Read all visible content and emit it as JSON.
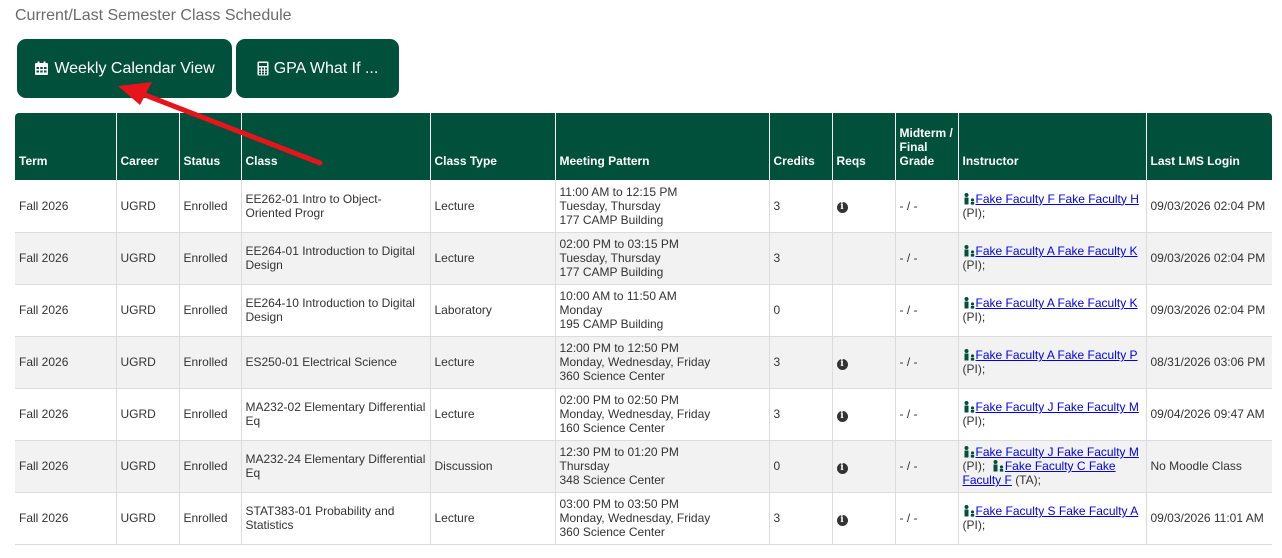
{
  "page": {
    "heading": "Current/Last Semester Class Schedule"
  },
  "buttons": {
    "weekly_label": "Weekly Calendar View",
    "gpa_label": "GPA What If ..."
  },
  "table": {
    "headers": {
      "term": "Term",
      "career": "Career",
      "status": "Status",
      "class": "Class",
      "class_type": "Class Type",
      "meeting": "Meeting Pattern",
      "credits": "Credits",
      "reqs": "Reqs",
      "grade_line1": "Midterm /",
      "grade_line2": "Final",
      "grade_line3": "Grade",
      "instructor": "Instructor",
      "lms": "Last LMS Login"
    },
    "rows": [
      {
        "term": "Fall 2026",
        "career": "UGRD",
        "status": "Enrolled",
        "class": "EE262-01 Intro to Object-Oriented Progr",
        "type": "Lecture",
        "time": "11:00 AM to 12:15 PM",
        "days": "Tuesday, Thursday",
        "location": "177 CAMP Building",
        "credits": "3",
        "grade": "- / -",
        "instructor": "Fake Faculty F Fake Faculty H",
        "role": "(PI);",
        "lms": "09/03/2026 02:04 PM"
      },
      {
        "term": "Fall 2026",
        "career": "UGRD",
        "status": "Enrolled",
        "class": "EE264-01 Introduction to Digital Design",
        "type": "Lecture",
        "time": "02:00 PM to 03:15 PM",
        "days": "Tuesday, Thursday",
        "location": "177 CAMP Building",
        "credits": "3",
        "grade": "- / -",
        "instructor": "Fake Faculty A Fake Faculty K",
        "role": "(PI);",
        "lms": "09/03/2026 02:04 PM"
      },
      {
        "term": "Fall 2026",
        "career": "UGRD",
        "status": "Enrolled",
        "class": "EE264-10 Introduction to Digital Design",
        "type": "Laboratory",
        "time": "10:00 AM to 11:50 AM",
        "days": "Monday",
        "location": "195 CAMP Building",
        "credits": "0",
        "grade": "- / -",
        "instructor": "Fake Faculty A Fake Faculty K",
        "role": "(PI);",
        "lms": "09/03/2026 02:04 PM"
      },
      {
        "term": "Fall 2026",
        "career": "UGRD",
        "status": "Enrolled",
        "class": "ES250-01 Electrical Science",
        "type": "Lecture",
        "time": "12:00 PM to 12:50 PM",
        "days": "Monday, Wednesday, Friday",
        "location": "360 Science Center",
        "credits": "3",
        "grade": "- / -",
        "instructor": "Fake Faculty A Fake Faculty P",
        "role": "(PI);",
        "lms": "08/31/2026 03:06 PM"
      },
      {
        "term": "Fall 2026",
        "career": "UGRD",
        "status": "Enrolled",
        "class": "MA232-02 Elementary Differential Eq",
        "type": "Lecture",
        "time": "02:00 PM to 02:50 PM",
        "days": "Monday, Wednesday, Friday",
        "location": "160 Science Center",
        "credits": "3",
        "grade": "- / -",
        "instructor": "Fake Faculty J Fake Faculty M",
        "role": "(PI);",
        "lms": "09/04/2026 09:47 AM"
      },
      {
        "term": "Fall 2026",
        "career": "UGRD",
        "status": "Enrolled",
        "class": "MA232-24 Elementary Differential Eq",
        "type": "Discussion",
        "time": "12:30 PM to 01:20 PM",
        "days": "Thursday",
        "location": "348 Science Center",
        "credits": "0",
        "grade": "- / -",
        "instructor": "Fake Faculty J Fake Faculty M",
        "role": "(PI);",
        "instructor2": "Fake Faculty C Fake Faculty F",
        "role2": "(TA);",
        "lms": "No Moodle Class"
      },
      {
        "term": "Fall 2026",
        "career": "UGRD",
        "status": "Enrolled",
        "class": "STAT383-01 Probability and Statistics",
        "type": "Lecture",
        "time": "03:00 PM to 03:50 PM",
        "days": "Monday, Wednesday, Friday",
        "location": "360 Science Center",
        "credits": "3",
        "grade": "- / -",
        "instructor": "Fake Faculty S Fake Faculty A",
        "role": "(PI);",
        "lms": "09/03/2026 11:01 AM"
      }
    ]
  },
  "colors": {
    "header_green": "#00503c",
    "link_blue": "#0000ee",
    "arrow_red": "#e8141b"
  },
  "icons": {
    "weekly": "calendar-icon",
    "gpa": "calculator-icon",
    "reqs": "info-circle-icon",
    "instructor": "person-icon"
  }
}
